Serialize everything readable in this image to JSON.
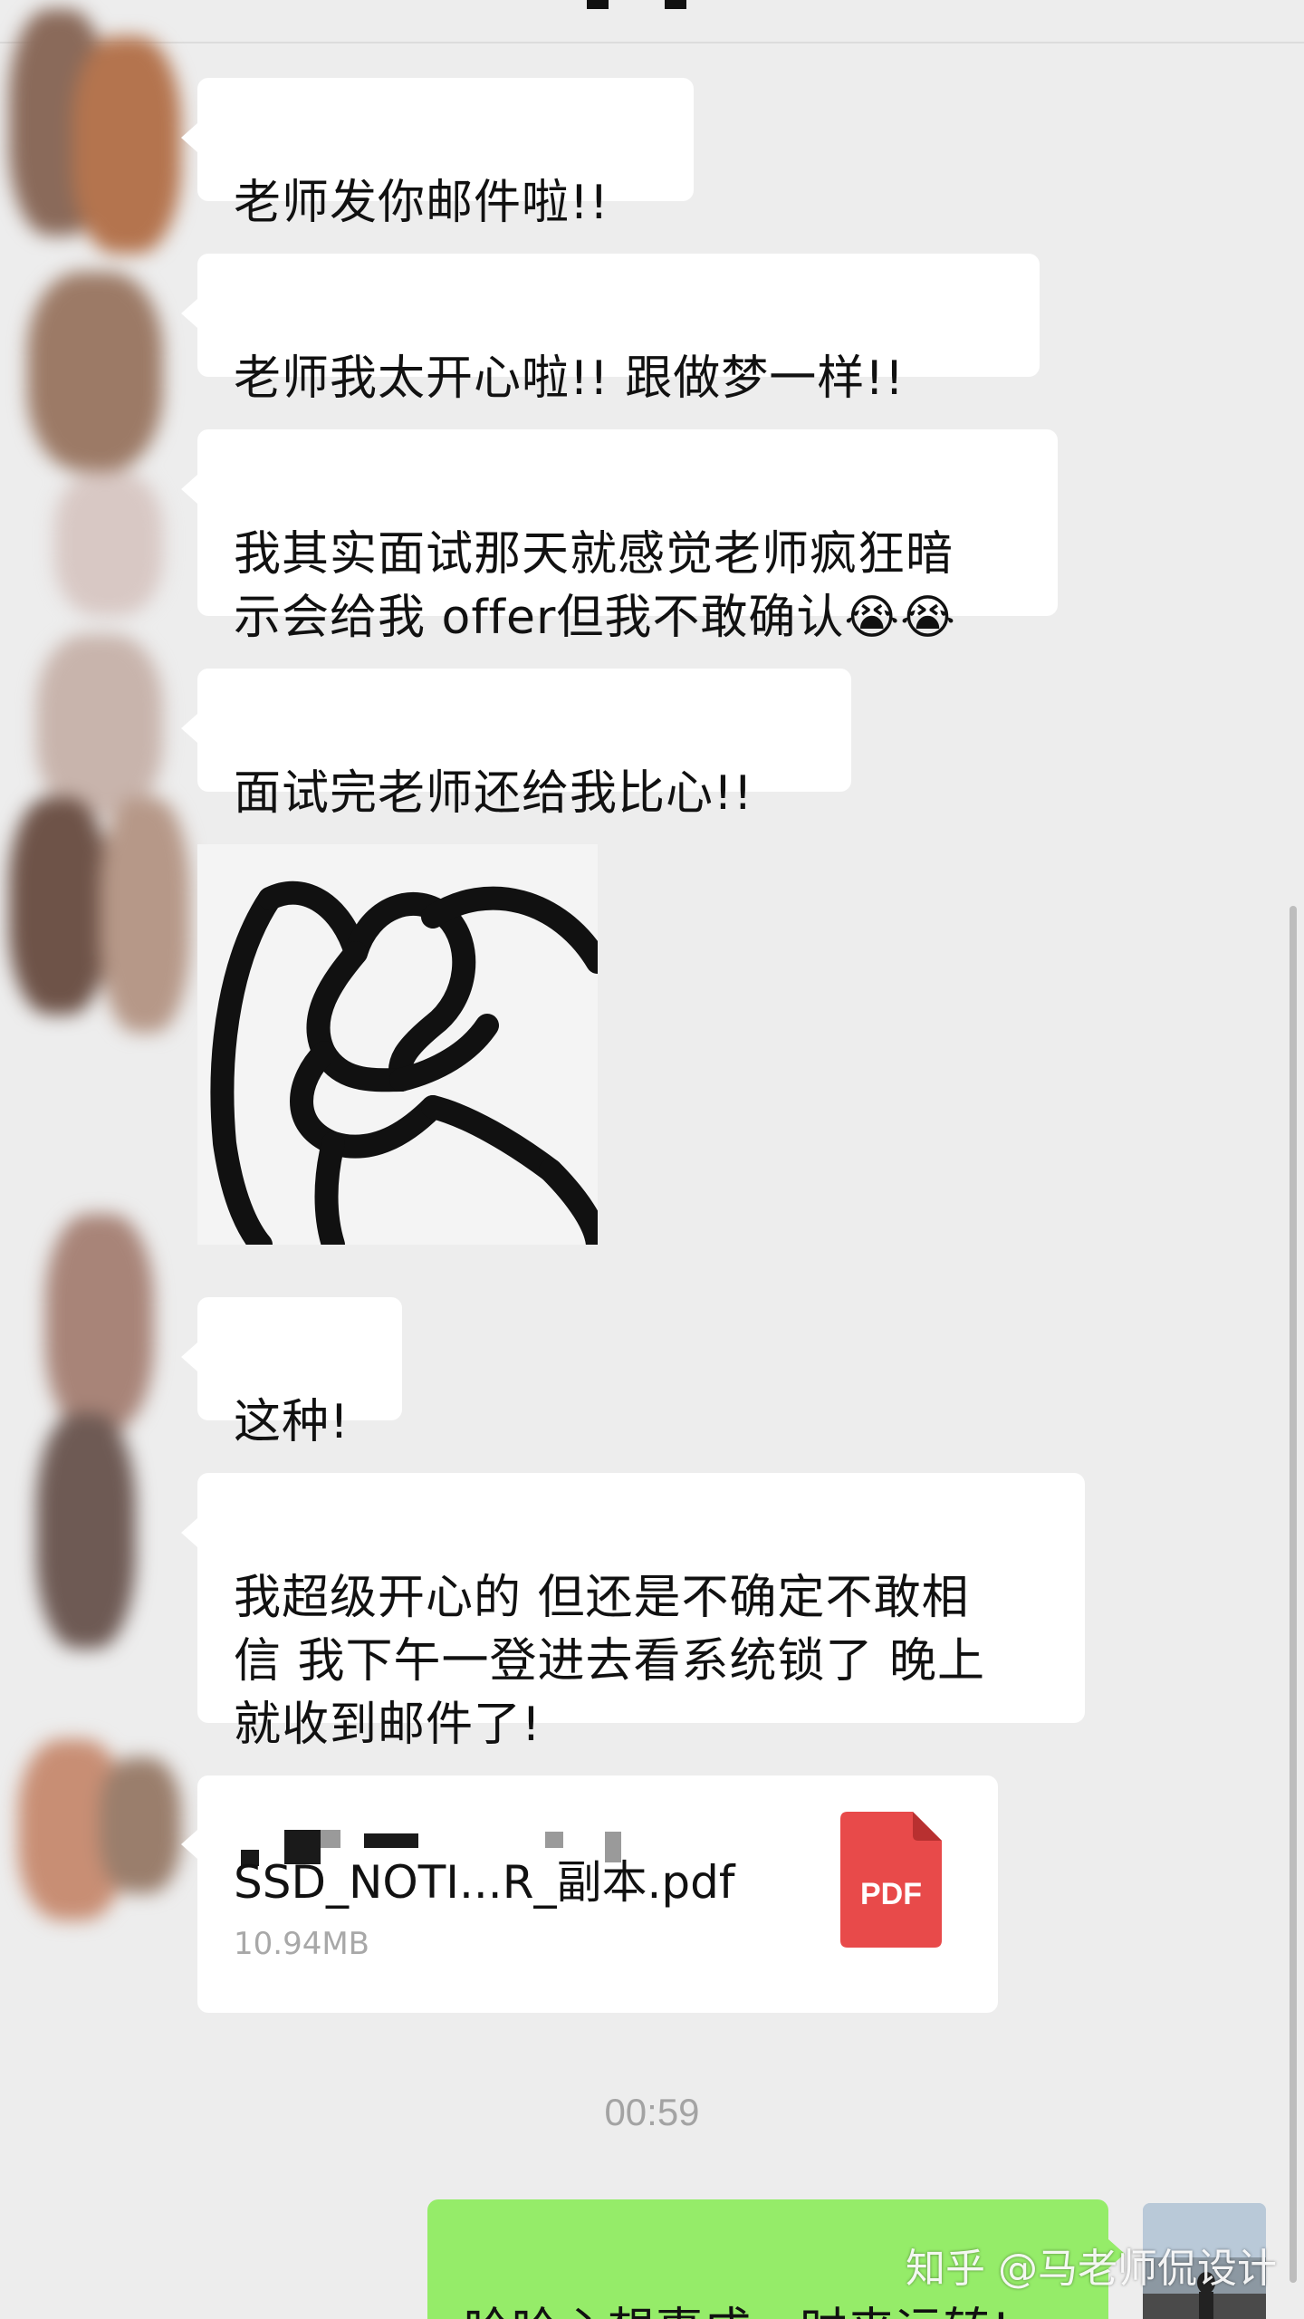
{
  "messages": [
    {
      "text": "老师发你邮件啦!!"
    },
    {
      "text": "老师我太开心啦!!  跟做梦一样!!"
    },
    {
      "text": "我其实面试那天就感觉老师疯狂暗\n示会给我 offer但我不敢确认😭😭"
    },
    {
      "text": "面试完老师还给我比心!!"
    },
    {
      "text": "这种!"
    },
    {
      "text": "我超级开心的 但还是不确定不敢相\n信 我下午一登进去看系统锁了 晚上\n就收到邮件了!"
    }
  ],
  "file": {
    "name": "SSD_NOTI...R_副本.pdf",
    "size": "10.94MB",
    "icon_label": "PDF",
    "icon": "pdf-file-icon",
    "icon_color": "#e84a4a"
  },
  "timestamp": "00:59",
  "reply": {
    "text": "哈哈心想事成，时来运转!"
  },
  "watermark": "知乎 @马老师侃设计",
  "colors": {
    "background": "#ededed",
    "bubble_in": "#ffffff",
    "bubble_out": "#95ec69"
  }
}
